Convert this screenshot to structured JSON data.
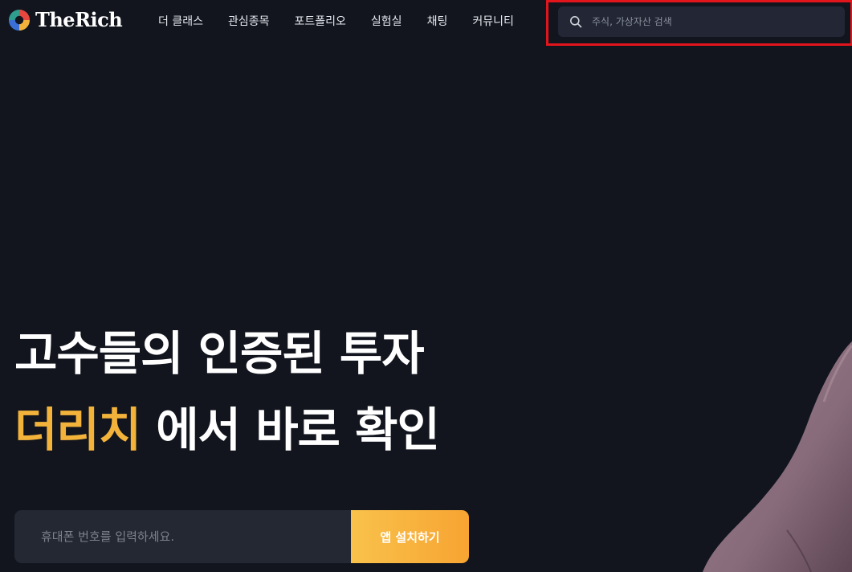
{
  "brand": {
    "name": "TheRich",
    "logo_colors": [
      "#e8473f",
      "#f3b33b",
      "#2f9e8f",
      "#3a6fd8"
    ]
  },
  "nav": {
    "items": [
      {
        "label": "더 클래스"
      },
      {
        "label": "관심종목"
      },
      {
        "label": "포트폴리오"
      },
      {
        "label": "실험실"
      },
      {
        "label": "채팅"
      },
      {
        "label": "커뮤니티"
      }
    ]
  },
  "search": {
    "placeholder": "주식, 가상자산 검색",
    "value": "",
    "highlight_color": "#e3151c"
  },
  "hero": {
    "line1": "고수들의 인증된 투자",
    "line2_accent": "더리치",
    "line2_rest": " 에서 바로 확인",
    "accent_color": "#f3b33b"
  },
  "signup": {
    "phone_placeholder": "휴대폰 번호를 입력하세요.",
    "phone_value": "",
    "install_label": "앱 설치하기"
  },
  "colors": {
    "background": "#12151e",
    "search_bg": "#232735",
    "input_bg": "#242833",
    "button_gradient": [
      "#f9c24b",
      "#f7a432"
    ]
  }
}
